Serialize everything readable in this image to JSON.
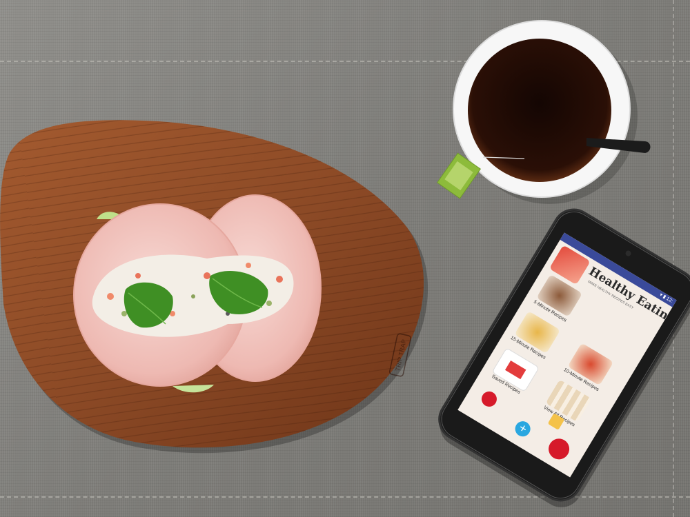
{
  "scene": {
    "background": "linen-tablecloth",
    "objects": [
      "wooden-cutting-board",
      "ham-sandwich",
      "coffee-cup",
      "tea-bag-tag",
      "smartphone"
    ]
  },
  "cutting_board": {
    "brand_stamp": "TRIP TRAP"
  },
  "phone": {
    "app": {
      "title": "Healthy Eating",
      "subtitle": "MAKE HEALTHY RECIPES EASY",
      "tiles": [
        {
          "label": "5-Minute Recipes",
          "icon": "meat-dish"
        },
        {
          "label": "15-Minute Recipes",
          "icon": "pasta-dish"
        },
        {
          "label": "10-Minute Recipes",
          "icon": "taco-dish"
        },
        {
          "label": "Saved Recipes",
          "icon": "document-icon"
        },
        {
          "label": "View All Recipes",
          "icon": "ingredients-grid"
        }
      ],
      "fab_symbol": "+",
      "accent_color": "#2aa7e0",
      "status_bar_color": "#3a4a9a"
    }
  },
  "colors": {
    "tablecloth": "#83827e",
    "board": "#8c4a26",
    "coffee": "#1c0a05",
    "basil": "#3f8f24",
    "ham": "#f2c9c4"
  }
}
